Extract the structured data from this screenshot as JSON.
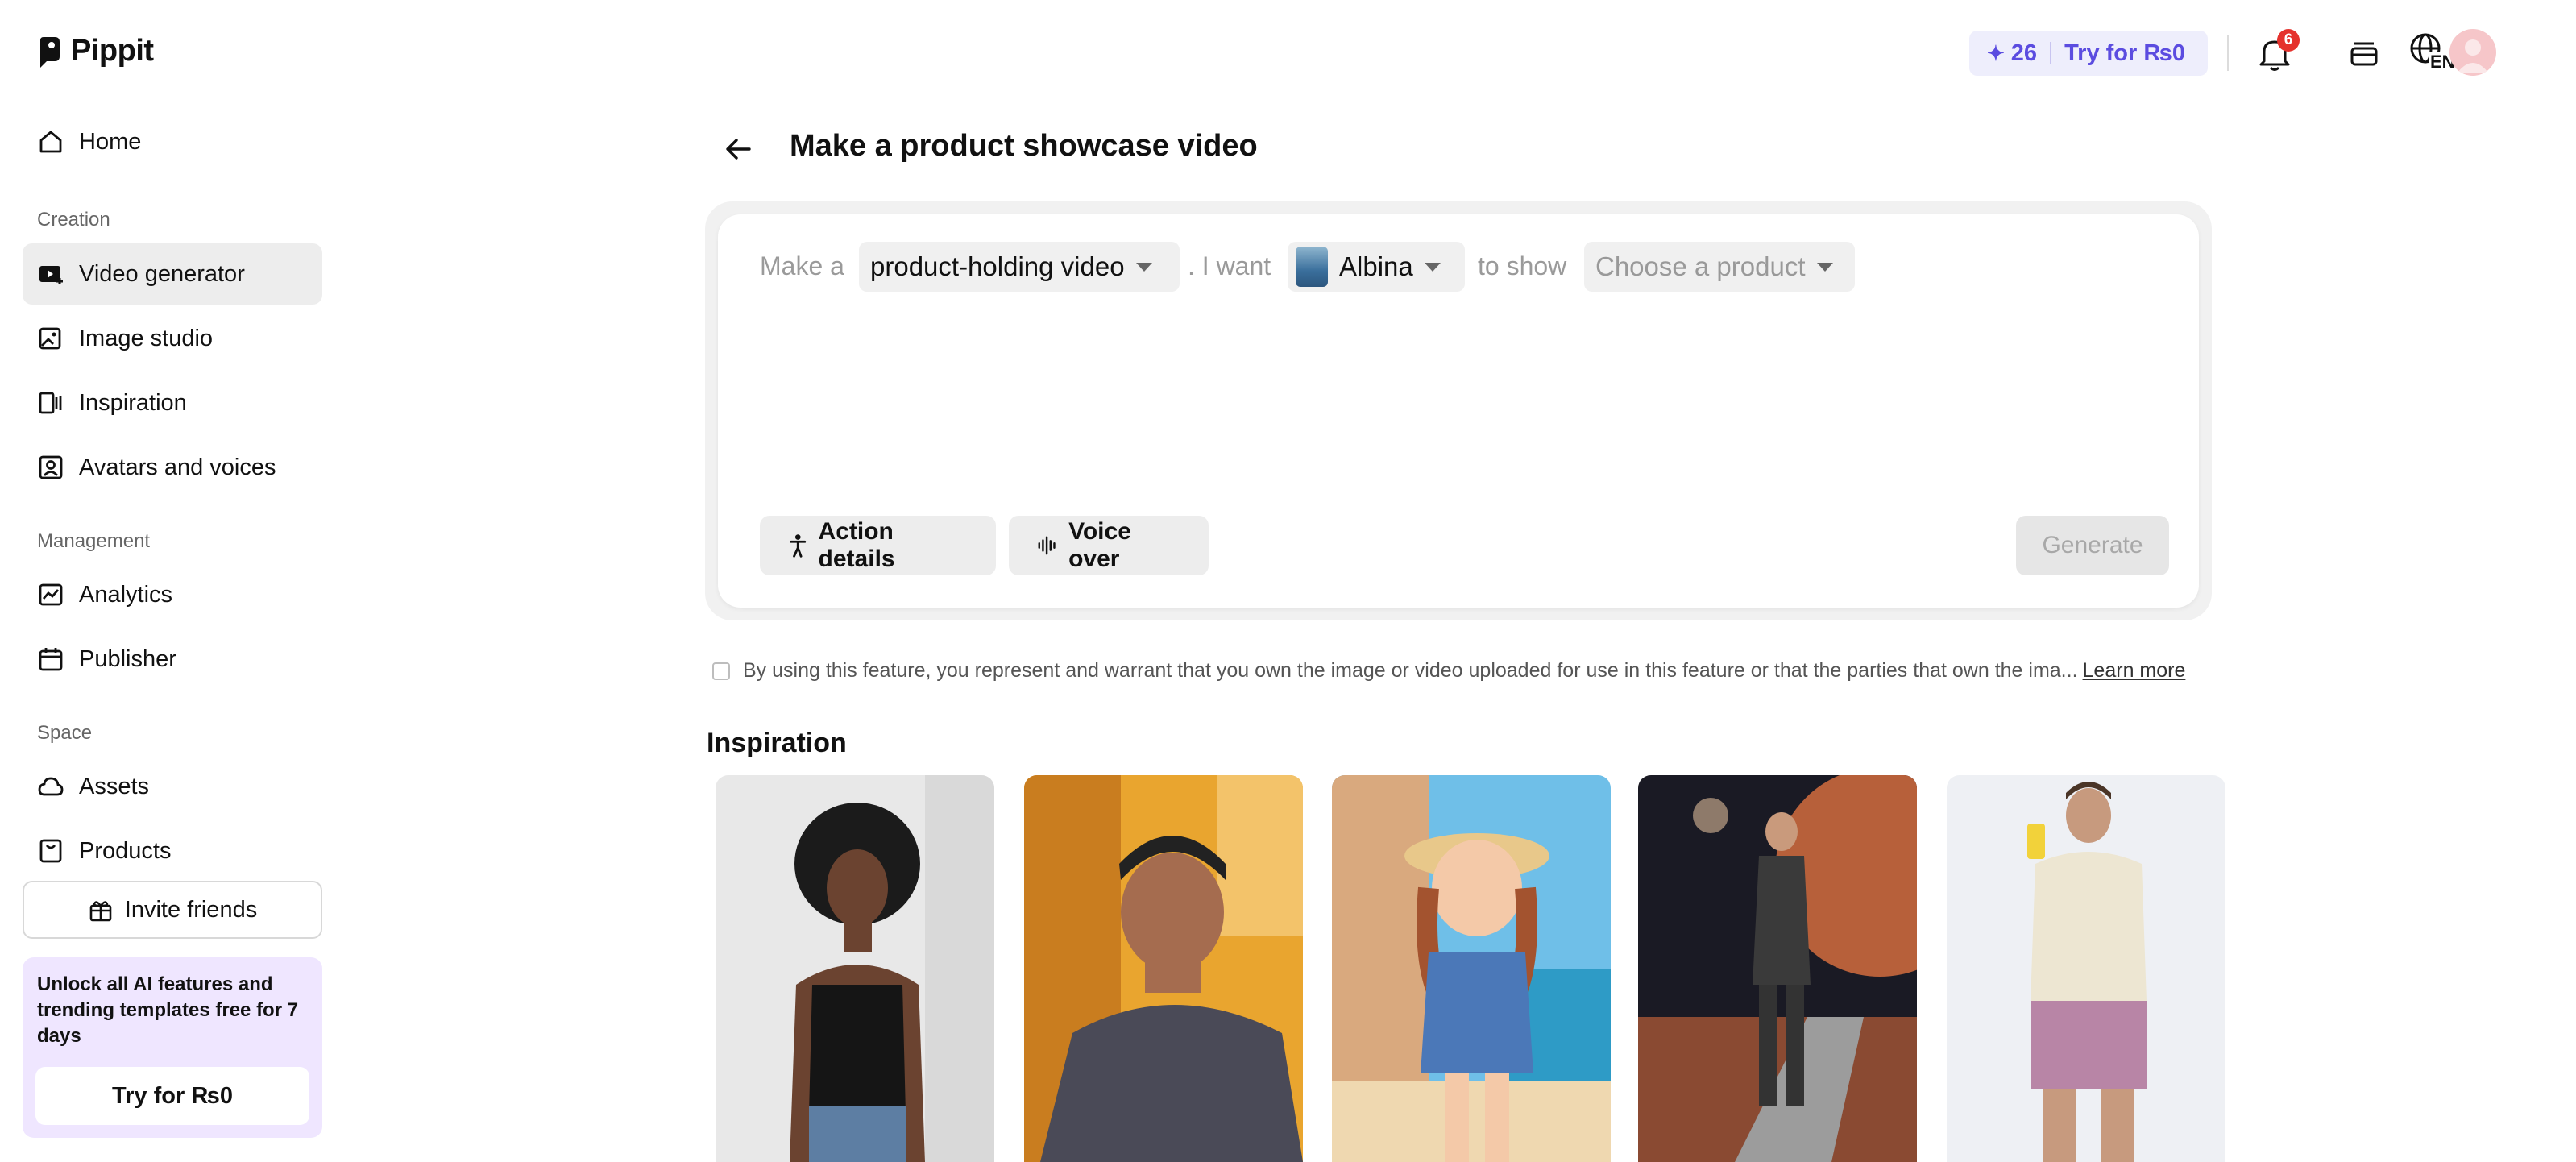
{
  "app": {
    "name": "Pippit"
  },
  "sidebar": {
    "home": "Home",
    "sections": {
      "creation": "Creation",
      "management": "Management",
      "space": "Space"
    },
    "items": {
      "video_generator": "Video generator",
      "image_studio": "Image studio",
      "inspiration": "Inspiration",
      "avatars_voices": "Avatars and voices",
      "analytics": "Analytics",
      "publisher": "Publisher",
      "assets": "Assets",
      "products": "Products"
    },
    "invite": "Invite friends",
    "promo": {
      "text": "Unlock all AI features and trending templates free for 7 days",
      "button": "Try for ₨0"
    }
  },
  "topbar": {
    "credits": "26",
    "try_label": "Try for ₨0",
    "notifications_count": "6",
    "language": "EN"
  },
  "main": {
    "title": "Make a product showcase video",
    "prompt": {
      "make_a": "Make a",
      "video_type": "product-holding video",
      "i_want": ". I want",
      "avatar": "Albina",
      "to_show": "to show",
      "product_placeholder": "Choose a product"
    },
    "buttons": {
      "action_details": "Action details",
      "voice_over": "Voice over",
      "generate": "Generate"
    },
    "consent": "By using this feature, you represent and warrant that you own the image or video uploaded for use in this feature or that the parties that own the ima...",
    "learn_more": "Learn more",
    "inspiration_title": "Inspiration"
  },
  "colors": {
    "accent": "#5b4ce0",
    "promo_bg": "#efe6ff",
    "active_nav": "#ededed",
    "badge": "#e5322d"
  }
}
